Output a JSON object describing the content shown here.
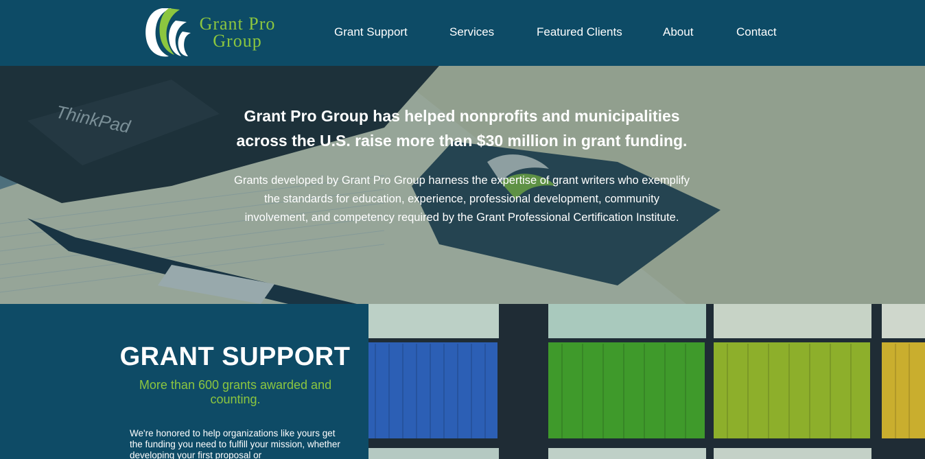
{
  "header": {
    "logo": {
      "line1": "Grant Pro",
      "line2": "Group"
    },
    "nav": [
      {
        "label": "Grant Support"
      },
      {
        "label": "Services"
      },
      {
        "label": "Featured Clients"
      },
      {
        "label": "About"
      },
      {
        "label": "Contact"
      }
    ]
  },
  "hero": {
    "title_line1": "Grant Pro Group has helped nonprofits and municipalities",
    "title_line2": "across the U.S. raise more than $30 million in grant funding.",
    "body": "Grants developed by Grant Pro Group harness the expertise of grant writers who exemplify the standards for education, experience, professional development, community involvement, and competency required by the Grant Professional Certification Institute.",
    "card_text": "Grant Pro Group"
  },
  "support": {
    "title": "GRANT SUPPORT",
    "subtitle": "More than 600 grants awarded and counting.",
    "body": "We're honored to help organizations like yours get the funding you need to fulfill your mission, whether developing your first proposal or"
  },
  "colors": {
    "header_bg": "#0d4b66",
    "accent_green": "#8cc63f",
    "text_white": "#ffffff"
  }
}
